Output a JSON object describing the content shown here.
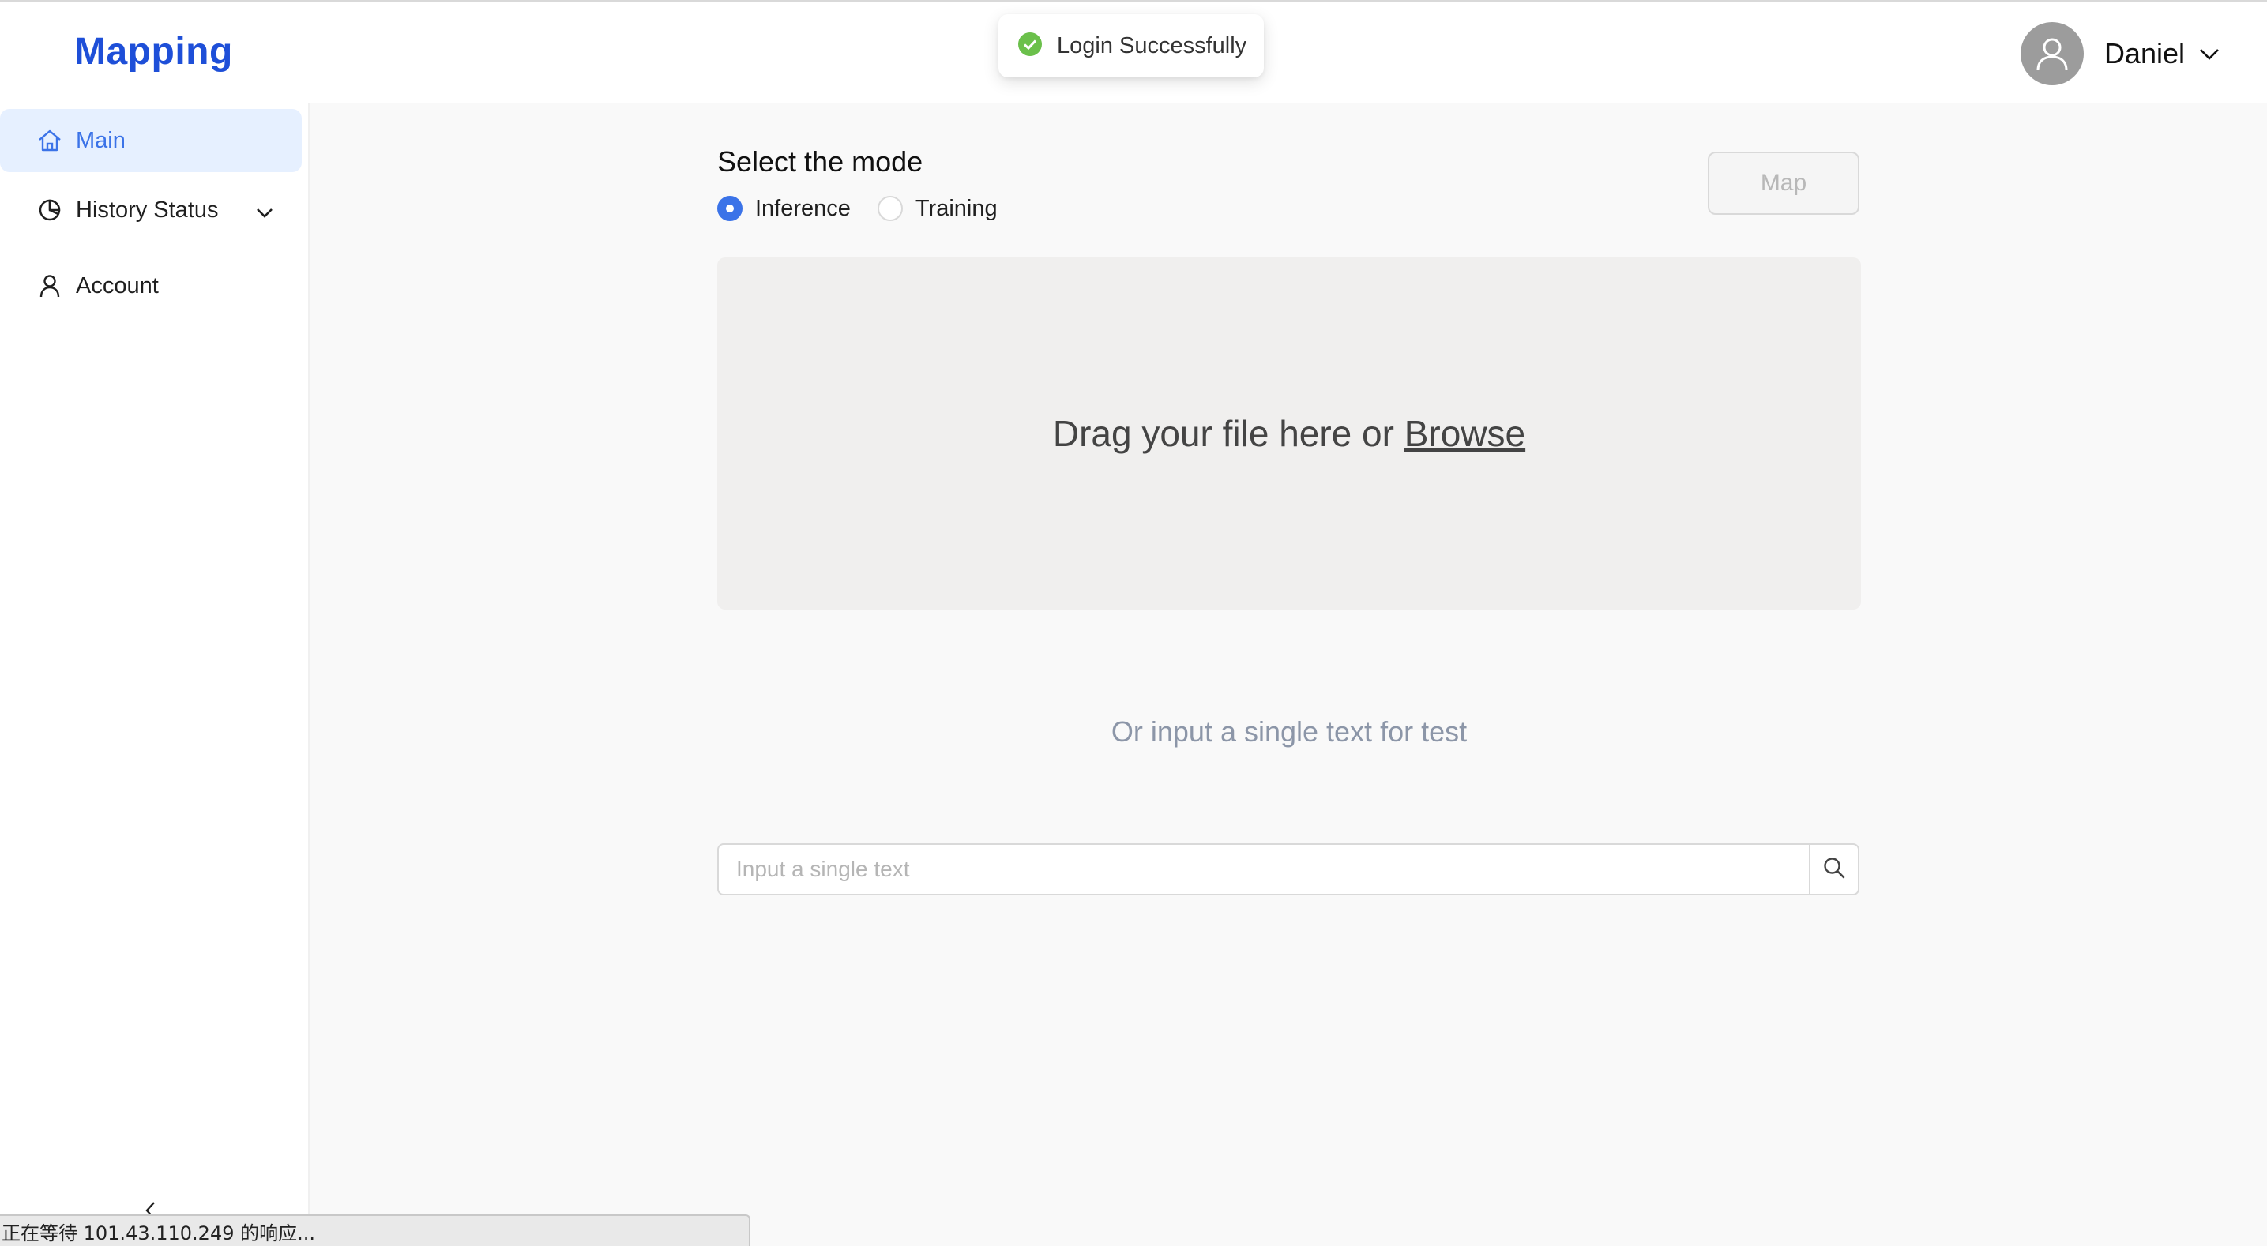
{
  "header": {
    "logo": "Mapping",
    "user": {
      "name": "Daniel",
      "avatar_icon": "user-avatar-icon"
    }
  },
  "toast": {
    "icon": "check-circle-icon",
    "text": "Login Successfully",
    "color": "#6bc04b"
  },
  "sidebar": {
    "items": [
      {
        "label": "Main",
        "icon": "home-icon",
        "active": true
      },
      {
        "label": "History Status",
        "icon": "pie-chart-icon",
        "expandable": true
      },
      {
        "label": "Account",
        "icon": "user-icon"
      }
    ],
    "collapse_icon": "chevron-left-icon"
  },
  "main": {
    "mode_title": "Select the mode",
    "modes": [
      {
        "label": "Inference",
        "checked": true
      },
      {
        "label": "Training",
        "checked": false
      }
    ],
    "map_button": "Map",
    "dropzone": {
      "text": "Drag your file here or",
      "link": "Browse"
    },
    "or_text": "Or input a single text for test",
    "search": {
      "placeholder": "Input a single text",
      "value": "",
      "icon": "search-icon"
    }
  },
  "status_bar": {
    "text": "正在等待 101.43.110.249 的响应..."
  },
  "colors": {
    "brand": "#1e4fd8",
    "accent": "#3b73e8",
    "active_bg": "#e6f0ff",
    "dropzone_bg": "#f0efee"
  }
}
